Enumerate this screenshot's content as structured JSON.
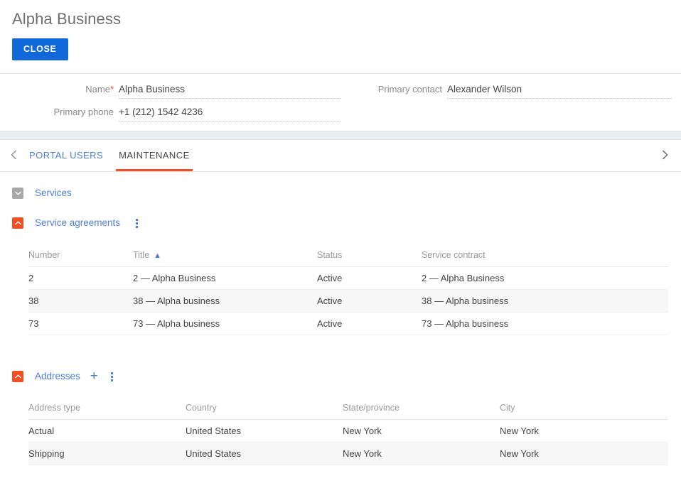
{
  "header": {
    "title": "Alpha Business",
    "close_label": "CLOSE"
  },
  "form": {
    "left": [
      {
        "label": "Name",
        "required": true,
        "value": "Alpha Business",
        "placeholder": ""
      },
      {
        "label": "Primary phone",
        "required": false,
        "value": "+1 (212) 1542 4236",
        "placeholder": ""
      }
    ],
    "right": [
      {
        "label": "Primary contact",
        "required": false,
        "value": "Alexander Wilson",
        "placeholder": ""
      }
    ],
    "required_marker": "*"
  },
  "tabs": {
    "prev_icon": "chevron-left-icon",
    "next_icon": "chevron-right-icon",
    "items": [
      {
        "label": "PORTAL USERS",
        "active": false
      },
      {
        "label": "MAINTENANCE",
        "active": true
      }
    ],
    "active_underline_color": "#f04e23"
  },
  "sections": {
    "services": {
      "title": "Services",
      "expanded": false,
      "toggle_icon": "chevron-down-icon",
      "toggle_color": "#a8a8a8"
    },
    "service_agreements": {
      "title": "Service agreements",
      "expanded": true,
      "toggle_icon": "chevron-up-icon",
      "toggle_color": "#f04e23",
      "menu_icon": "kebab-menu-icon",
      "table": {
        "columns": [
          "Number",
          "Title",
          "Status",
          "Service contract"
        ],
        "sorted_column": "Title",
        "sort_direction": "asc",
        "sort_icon": "caret-up-icon",
        "rows": [
          [
            "2",
            "2 — Alpha Business",
            "Active",
            "2 — Alpha Business"
          ],
          [
            "38",
            "38 — Alpha business",
            "Active",
            "38 — Alpha business"
          ],
          [
            "73",
            "73 — Alpha business",
            "Active",
            "73 — Alpha business"
          ]
        ]
      }
    },
    "addresses": {
      "title": "Addresses",
      "expanded": true,
      "toggle_icon": "chevron-up-icon",
      "toggle_color": "#f04e23",
      "add_icon": "plus-icon",
      "menu_icon": "kebab-menu-icon",
      "table": {
        "columns": [
          "Address type",
          "Country",
          "State/province",
          "City"
        ],
        "rows": [
          [
            "Actual",
            "United States",
            "New York",
            "New York"
          ],
          [
            "Shipping",
            "United States",
            "New York",
            "New York"
          ]
        ]
      }
    }
  },
  "colors": {
    "accent_blue": "#1168d9",
    "link_blue": "#4e7fd4",
    "accent_orange": "#f04e23",
    "required_red": "#e8553a"
  }
}
